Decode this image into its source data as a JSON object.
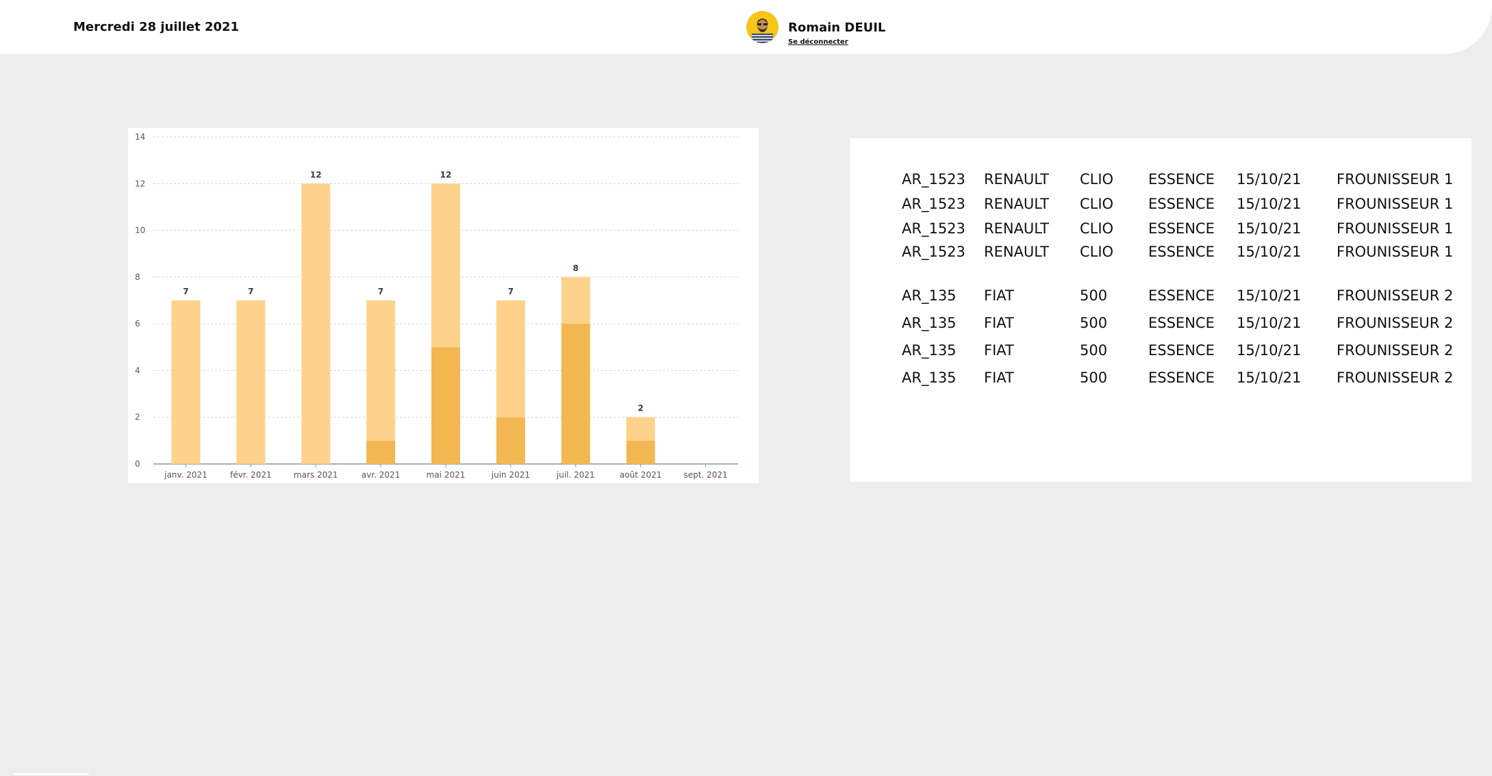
{
  "header": {
    "date": "Mercredi 28 juillet 2021",
    "user_name": "Romain DEUIL",
    "logout_label": "Se déconnecter"
  },
  "colors": {
    "bar_light": "#fdd38b",
    "bar_dark": "#f3b752",
    "axis": "#7f95b5",
    "grid": "#d4d4d4",
    "avatar_bg": "#f5c518"
  },
  "chart_data": {
    "type": "bar",
    "stacked": true,
    "categories": [
      "janv. 2021",
      "févr. 2021",
      "mars 2021",
      "avr. 2021",
      "mai 2021",
      "juin 2021",
      "juil. 2021",
      "août 2021",
      "sept. 2021"
    ],
    "series": [
      {
        "values": [
          0,
          0,
          0,
          1,
          5,
          2,
          6,
          1,
          0
        ]
      },
      {
        "values": [
          7,
          7,
          12,
          6,
          7,
          5,
          2,
          1,
          0
        ]
      }
    ],
    "totals": [
      "7",
      "7",
      "12",
      "7",
      "12",
      "7",
      "8",
      "2",
      ""
    ],
    "yticks": [
      "0",
      "2",
      "4",
      "6",
      "8",
      "10",
      "12",
      "14"
    ],
    "ylim": [
      0,
      14
    ],
    "grid": true,
    "title": "",
    "xlabel": "",
    "ylabel": ""
  },
  "table": {
    "rows": [
      [
        "AR_1523",
        "RENAULT",
        "CLIO",
        "ESSENCE",
        "15/10/21",
        "FROUNISSEUR 1"
      ],
      [
        "AR_1523",
        "RENAULT",
        "CLIO",
        "ESSENCE",
        "15/10/21",
        "FROUNISSEUR 1"
      ],
      [
        "AR_1523",
        "RENAULT",
        "CLIO",
        "ESSENCE",
        "15/10/21",
        "FROUNISSEUR 1"
      ],
      [
        "AR_1523",
        "RENAULT",
        "CLIO",
        "ESSENCE",
        "15/10/21",
        "FROUNISSEUR 1"
      ],
      [
        "AR_135",
        "FIAT",
        "500",
        "ESSENCE",
        "15/10/21",
        "FROUNISSEUR 2"
      ],
      [
        "AR_135",
        "FIAT",
        "500",
        "ESSENCE",
        "15/10/21",
        "FROUNISSEUR 2"
      ],
      [
        "AR_135",
        "FIAT",
        "500",
        "ESSENCE",
        "15/10/21",
        "FROUNISSEUR 2"
      ],
      [
        "AR_135",
        "FIAT",
        "500",
        "ESSENCE",
        "15/10/21",
        "FROUNISSEUR 2"
      ]
    ]
  }
}
